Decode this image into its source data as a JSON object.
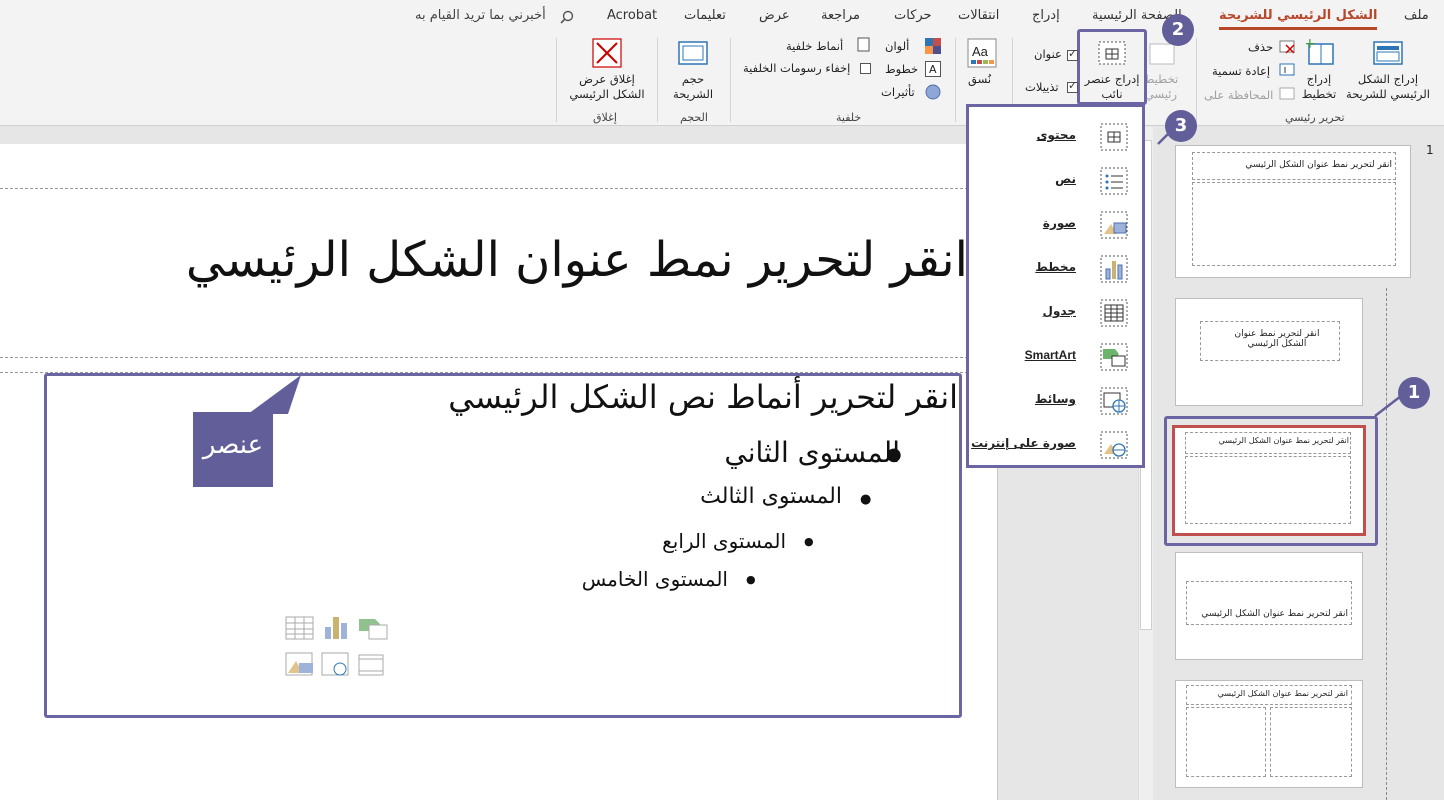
{
  "tabs": [
    {
      "label": "ملف",
      "active": false
    },
    {
      "label": "الشكل الرئيسي للشريحة",
      "active": true
    },
    {
      "label": "الصفحة الرئيسية",
      "active": false
    },
    {
      "label": "إدراج",
      "active": false
    },
    {
      "label": "انتقالات",
      "active": false
    },
    {
      "label": "حركات",
      "active": false
    },
    {
      "label": "مراجعة",
      "active": false
    },
    {
      "label": "عرض",
      "active": false
    },
    {
      "label": "تعليمات",
      "active": false
    },
    {
      "label": "Acrobat",
      "active": false
    }
  ],
  "tell_me": "أخبرني بما تريد القيام به",
  "ribbon": {
    "edit_master": {
      "insert_master": "إدراج الشكل\nالرئيسي للشريحة",
      "insert_layout": "إدراج\nتخطيط",
      "delete": "حذف",
      "rename": "إعادة تسمية",
      "preserve": "المحافظة على",
      "group_label": "تحرير رئيسي"
    },
    "master_layout": {
      "master_layout_btn": "تخطيط\nرئيسي",
      "insert_placeholder": "إدراج عنصر\nنائب",
      "title_chk": "عنوان",
      "footers_chk": "تذييلات"
    },
    "theme": {
      "themes_btn": "نُسق"
    },
    "background": {
      "colors": "ألوان",
      "fonts": "خطوط",
      "effects": "تأثيرات",
      "bg_styles": "أنماط خلفية",
      "hide_bg": "إخفاء رسومات الخلفية",
      "group_label": "خلفية"
    },
    "size": {
      "slide_size": "حجم\nالشريحة",
      "group_label": "الحجم"
    },
    "close": {
      "close_master": "إغلاق عرض\nالشكل الرئيسي",
      "group_label": "إغلاق"
    }
  },
  "slide": {
    "title": "انقر لتحرير نمط عنوان الشكل الرئيسي",
    "level1": "انقر لتحرير أنماط نص الشكل الرئيسي",
    "level2": "المستوى الثاني",
    "level3": "المستوى الثالث",
    "level4": "المستوى الرابع",
    "level5": "المستوى الخامس"
  },
  "callout": "عنصر",
  "dropdown": [
    {
      "label": "محتوى",
      "icon": "content-icon"
    },
    {
      "label": "نص",
      "icon": "text-icon"
    },
    {
      "label": "صورة",
      "icon": "picture-icon"
    },
    {
      "label": "مخطط",
      "icon": "chart-icon"
    },
    {
      "label": "جدول",
      "icon": "table-icon"
    },
    {
      "label": "SmartArt",
      "icon": "smartart-icon"
    },
    {
      "label": "وسائط",
      "icon": "media-icon"
    },
    {
      "label": "صورة على إنترنت",
      "icon": "online-picture-icon"
    }
  ],
  "thumbnails": {
    "slide_number": "1",
    "t1_title": "انقر لتحرير نمط عنوان الشكل الرئيسي",
    "t2_title": "انقر لتحرير نمط عنوان الشكل الرئيسي",
    "t3_title": "انقر لتحرير نمط عنوان الشكل الرئيسي",
    "t4_title": "انقر لتحرير نمط عنوان الشكل الرئيسي",
    "t5_title": "انقر لتحرير نمط عنوان الشكل الرئيسي"
  },
  "badges": [
    "1",
    "2",
    "3"
  ],
  "colors": {
    "accent": "#6b66a3",
    "tab_active": "#b7472a",
    "selected_thumb": "#c0504d"
  }
}
